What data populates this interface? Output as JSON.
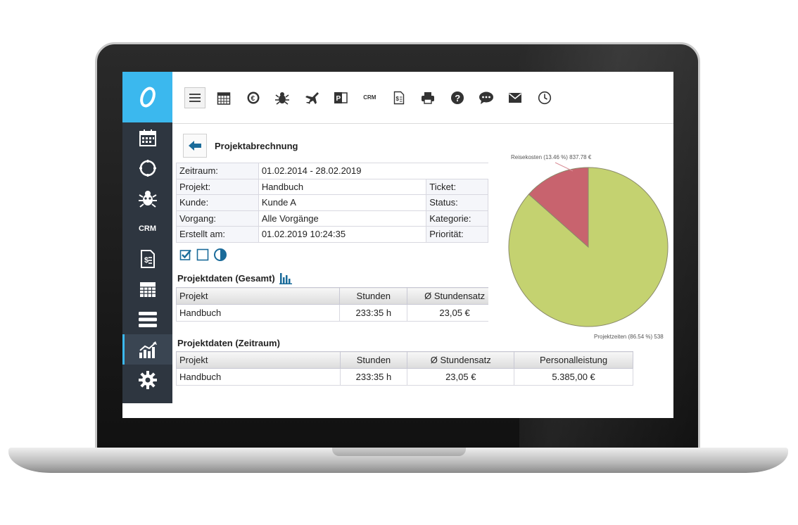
{
  "toolbar": {
    "buttons": [
      "menu-icon",
      "calendar-icon",
      "euro-coin-icon",
      "bug-icon",
      "plane-icon",
      "powerpoint-icon",
      "crm",
      "invoice-icon",
      "printer-icon",
      "help-icon",
      "chat-icon",
      "mail-icon",
      "clock-icon"
    ],
    "crm_label": "CRM"
  },
  "sidebar": {
    "items": [
      "calendar-icon",
      "compass-icon",
      "bug-icon",
      "crm",
      "invoice-icon",
      "table-calendar-icon",
      "list-icon",
      "chart-icon",
      "gear-icon"
    ],
    "crm_label": "CRM",
    "active": "chart-icon"
  },
  "page": {
    "title": "Projektabrechnung"
  },
  "info": {
    "zeitraum_label": "Zeitraum:",
    "zeitraum_value": "01.02.2014 - 28.02.2019",
    "projekt_label": "Projekt:",
    "projekt_value": "Handbuch",
    "ticket_label": "Ticket:",
    "kunde_label": "Kunde:",
    "kunde_value": "Kunde A",
    "status_label": "Status:",
    "vorgang_label": "Vorgang:",
    "vorgang_value": "Alle Vorgänge",
    "kategorie_label": "Kategorie:",
    "erstellt_label": "Erstellt am:",
    "erstellt_value": "01.02.2019 10:24:35",
    "prioritaet_label": "Priorität:"
  },
  "gesamt": {
    "title": "Projektdaten (Gesamt)",
    "headers": [
      "Projekt",
      "Stunden",
      "Ø Stundensatz"
    ],
    "row": [
      "Handbuch",
      "233:35 h",
      "23,05 €"
    ]
  },
  "zeitraum": {
    "title": "Projektdaten (Zeitraum)",
    "headers": [
      "Projekt",
      "Stunden",
      "Ø Stundensatz",
      "Personalleistung"
    ],
    "row": [
      "Handbuch",
      "233:35 h",
      "23,05 €",
      "5.385,00 €"
    ]
  },
  "chart_data": {
    "type": "pie",
    "slices": [
      {
        "label": "Reisekosten (13.46 %) 837.78 €",
        "value": 13.46,
        "color": "#c8636e"
      },
      {
        "label": "Projektzeiten (86.54 %) 538",
        "value": 86.54,
        "color": "#c4d270"
      }
    ]
  }
}
